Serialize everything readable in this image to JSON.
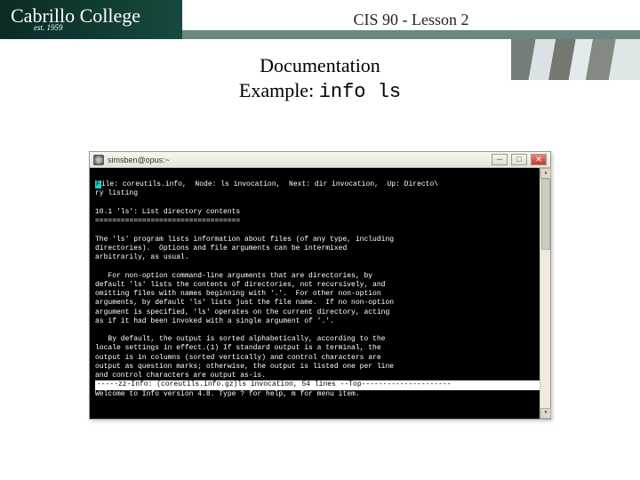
{
  "header": {
    "logo_text": "Cabrillo College",
    "logo_est": "est. 1959",
    "course_title": "CIS 90 - Lesson 2"
  },
  "subtitle": {
    "line1": "Documentation",
    "line2_label": "Example: ",
    "line2_cmd": "info ls"
  },
  "terminal": {
    "window_title": "simsben@opus:~",
    "header_line_pre": "F",
    "header_line": "ile: coreutils.info,  Node: ls invocation,  Next: dir invocation,  Up: Directo\\",
    "header_line2": "ry listing",
    "body": "10.1 'ls': List directory contents\n==================================\n\nThe 'ls' program lists information about files (of any type, including\ndirectories).  Options and file arguments can be intermixed\narbitrarily, as usual.\n\n   For non-option command-line arguments that are directories, by\ndefault 'ls' lists the contents of directories, not recursively, and\nomitting files with names beginning with '.'.  For other non-option\narguments, by default 'ls' lists just the file name.  If no non-option\nargument is specified, 'ls' operates on the current directory, acting\nas if it had been invoked with a single argument of '.'.\n\n   By default, the output is sorted alphabetically, according to the\nlocale settings in effect.(1) If standard output is a terminal, the\noutput is in columns (sorted vertically) and control characters are\noutput as question marks; otherwise, the output is listed one per line\nand control characters are output as-is.",
    "status_line": "-----zz-Info: (coreutils.info.gz)ls invocation, 54 lines --Top---------------------",
    "help_line": "Welcome to Info version 4.8. Type ? for help, m for menu item."
  }
}
